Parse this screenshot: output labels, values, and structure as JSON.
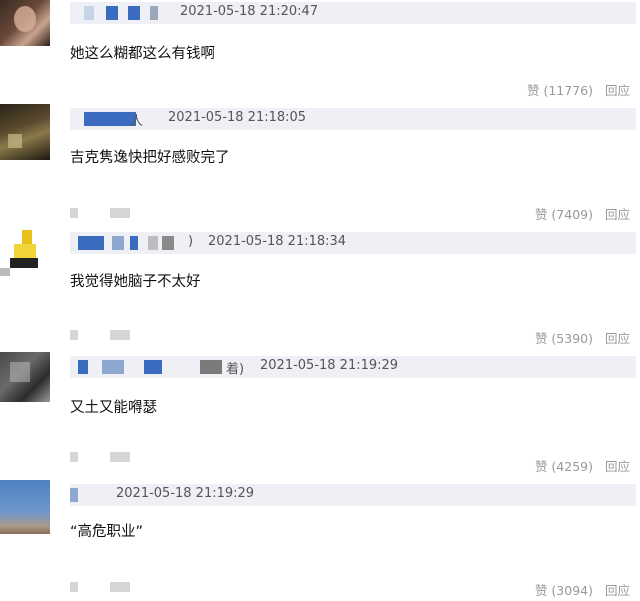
{
  "comments": [
    {
      "timestamp": "2021-05-18 21:20:47",
      "text": "她这么糊都这么有钱啊",
      "like_label": "赞 (11776)",
      "reply_label": "回应"
    },
    {
      "user_suffix": "人",
      "timestamp": "2021-05-18 21:18:05",
      "text": "吉克隽逸快把好感败完了",
      "like_label": "赞 (7409)",
      "reply_label": "回应"
    },
    {
      "user_suffix": ")",
      "timestamp": "2021-05-18 21:18:34",
      "text": "我觉得她脑子不太好",
      "like_label": "赞 (5390)",
      "reply_label": "回应"
    },
    {
      "user_suffix": "着)",
      "timestamp": "2021-05-18 21:19:29",
      "text": "又土又能嘚瑟",
      "like_label": "赞 (4259)",
      "reply_label": "回应"
    },
    {
      "timestamp": "2021-05-18 21:19:29",
      "text": "“高危职业”",
      "like_label": "赞 (3094)",
      "reply_label": "回应"
    }
  ],
  "colors": {
    "meta_bar": "#eef0f5",
    "username_blur": "#3a6bbf",
    "muted_text": "#999999"
  },
  "icons": [
    "avatar-image"
  ]
}
